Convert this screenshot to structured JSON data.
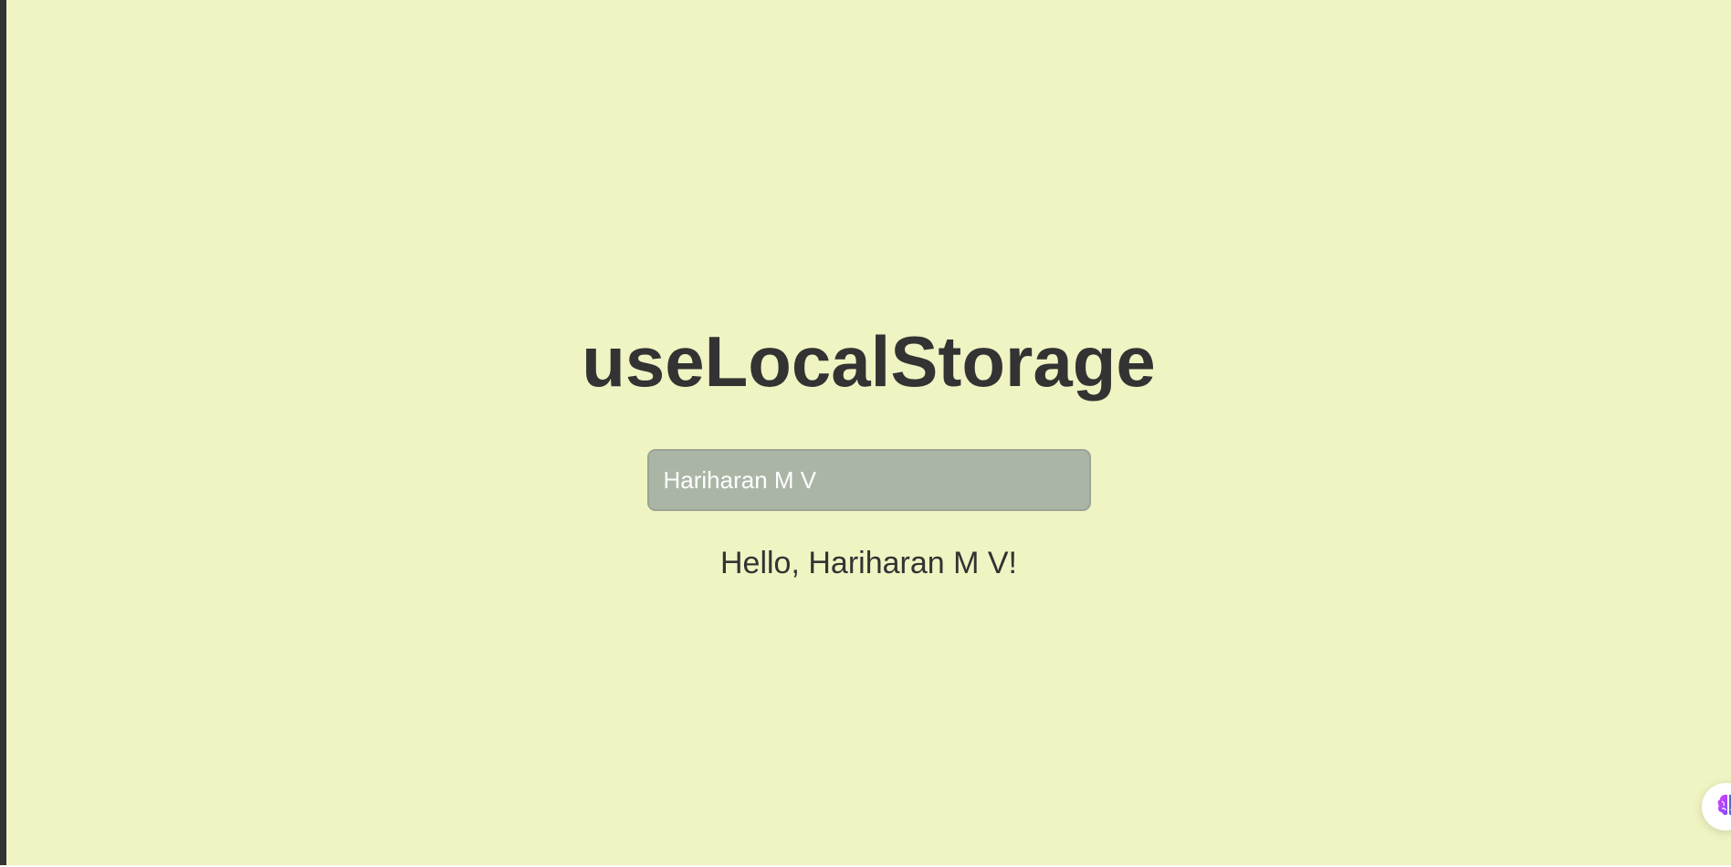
{
  "app": {
    "title": "useLocalStorage",
    "input_value": "Hariharan M V",
    "greeting": "Hello, Hariharan M V!"
  },
  "widget": {
    "icon": "brain-icon"
  },
  "colors": {
    "background": "#f0f4c3",
    "text": "#333333",
    "input_background": "#aab5a6",
    "input_text": "#ffffff"
  }
}
